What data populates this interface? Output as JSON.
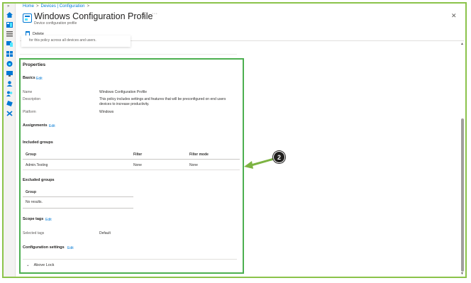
{
  "breadcrumb": {
    "home": "Home",
    "sep1": ">",
    "devices": "Devices | Configuration",
    "sep2": ">"
  },
  "header": {
    "title": "Windows Configuration Profile",
    "subtitle": "Device configuration profile",
    "pin_icon": "pin-icon",
    "more": "···",
    "close": "✕"
  },
  "toolbar": {
    "delete_label": "Delete"
  },
  "partial_card_text": "for this policy across all devices and users.",
  "properties": {
    "heading": "Properties",
    "basics": {
      "label": "Basics",
      "edit": "Edit"
    },
    "name_label": "Name",
    "name_value": "Windows Configuration Profile",
    "description_label": "Description",
    "description_value": "This policy includes settings and features that will be preconfigured on end users devices to increase productivity.",
    "platform_label": "Platform",
    "platform_value": "Windows",
    "assignments": {
      "label": "Assignments",
      "edit": "Edit"
    },
    "included_groups": {
      "label": "Included groups",
      "columns": [
        "Group",
        "Filter",
        "Filter mode"
      ],
      "rows": [
        [
          "Admin.Testing",
          "None",
          "None"
        ]
      ]
    },
    "excluded_groups": {
      "label": "Excluded groups",
      "column": "Group",
      "empty": "No results."
    },
    "scope_tags": {
      "label": "Scope tags",
      "edit": "Edit",
      "selected_label": "Selected tags",
      "selected_value": "Default"
    },
    "configuration_settings": {
      "label": "Configuration settings",
      "edit": "Edit"
    },
    "accordion": {
      "chevron": "⌄",
      "label": "Above Lock"
    }
  },
  "callout": {
    "number": "2"
  },
  "colors": {
    "accent": "#0078d4",
    "highlight_box": "#4caf50",
    "frame": "#8bc34a",
    "arrow": "#7cb342"
  },
  "rail_icons": [
    "home-icon",
    "dashboard-icon",
    "list-icon",
    "devices-icon",
    "apps-icon",
    "endpoint-security-icon",
    "monitor-icon",
    "users-icon",
    "groups-icon",
    "tenant-admin-icon",
    "troubleshooting-icon"
  ]
}
